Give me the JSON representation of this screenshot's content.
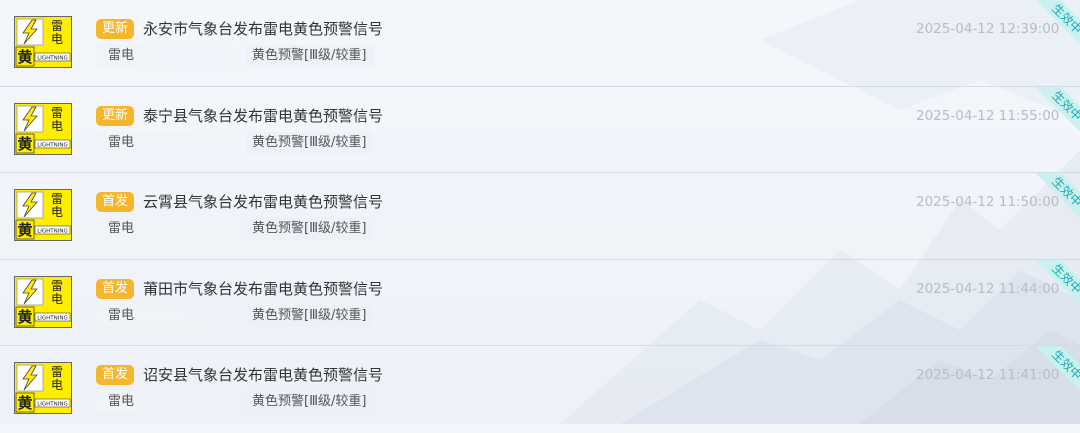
{
  "colors": {
    "tag_bg": "#f6b62c",
    "icon_yellow": "#ffee00",
    "ribbon_bg": "#c9f1f0",
    "ribbon_text": "#1ea9b2"
  },
  "icon": {
    "semantic": "lightning-yellow-warning-icon",
    "char_thunder": "雷",
    "char_electric": "电",
    "char_yellow": "黄",
    "english": "LIGHTNING"
  },
  "warnings": [
    {
      "tag": "更新",
      "title": "永安市气象台发布雷电黄色预警信号",
      "time": "2025-04-12 12:39:00",
      "type": "雷电",
      "level": "黄色预警[Ⅲ级/较重]",
      "status": "生效中"
    },
    {
      "tag": "更新",
      "title": "泰宁县气象台发布雷电黄色预警信号",
      "time": "2025-04-12 11:55:00",
      "type": "雷电",
      "level": "黄色预警[Ⅲ级/较重]",
      "status": "生效中"
    },
    {
      "tag": "首发",
      "title": "云霄县气象台发布雷电黄色预警信号",
      "time": "2025-04-12 11:50:00",
      "type": "雷电",
      "level": "黄色预警[Ⅲ级/较重]",
      "status": "生效中"
    },
    {
      "tag": "首发",
      "title": "莆田市气象台发布雷电黄色预警信号",
      "time": "2025-04-12 11:44:00",
      "type": "雷电",
      "level": "黄色预警[Ⅲ级/较重]",
      "status": "生效中"
    },
    {
      "tag": "首发",
      "title": "诏安县气象台发布雷电黄色预警信号",
      "time": "2025-04-12 11:41:00",
      "type": "雷电",
      "level": "黄色预警[Ⅲ级/较重]",
      "status": "生效中"
    }
  ]
}
